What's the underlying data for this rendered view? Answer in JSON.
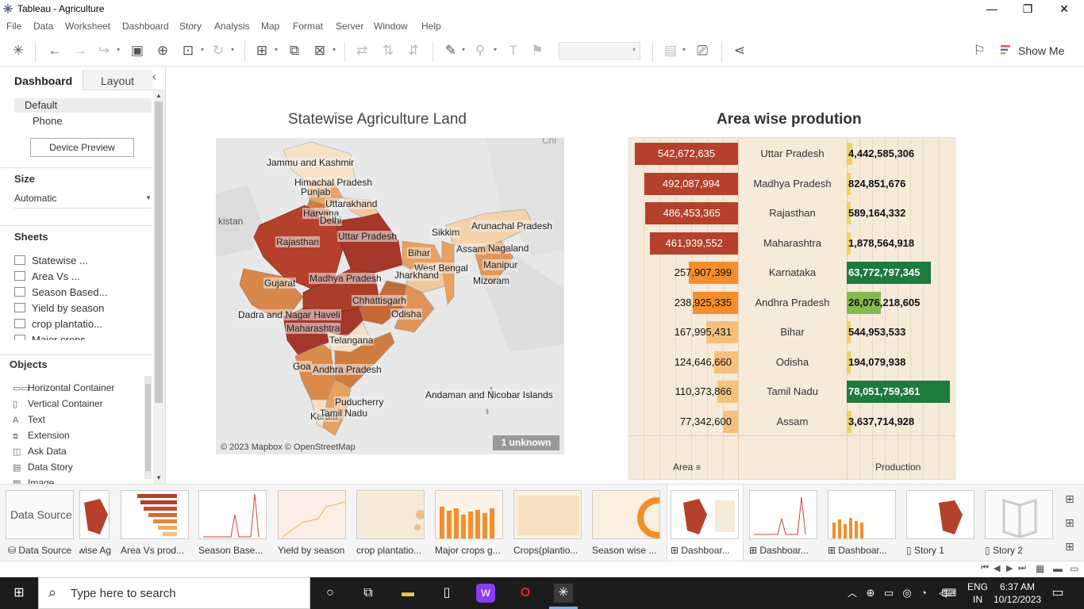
{
  "app": {
    "title": "Tableau - Agriculture"
  },
  "menu": [
    "File",
    "Data",
    "Worksheet",
    "Dashboard",
    "Story",
    "Analysis",
    "Map",
    "Format",
    "Server",
    "Window",
    "Help"
  ],
  "toolbar": {
    "show_me": "Show Me"
  },
  "left_pane": {
    "tabs": [
      "Dashboard",
      "Layout"
    ],
    "device": {
      "default": "Default",
      "phone": "Phone",
      "preview_button": "Device Preview"
    },
    "size": {
      "header": "Size",
      "value": "Automatic"
    },
    "sheets": {
      "header": "Sheets",
      "items": [
        "Statewise ...",
        "Area Vs ...",
        "Season Based...",
        "Yield by season",
        "crop plantatio...",
        "Major crops ..."
      ]
    },
    "objects": {
      "header": "Objects",
      "items": [
        {
          "icon": "horizontal-container-icon",
          "label": "Horizontal Container"
        },
        {
          "icon": "vertical-container-icon",
          "label": "Vertical Container"
        },
        {
          "icon": "text-icon",
          "label": "Text"
        },
        {
          "icon": "extension-icon",
          "label": "Extension"
        },
        {
          "icon": "ask-data-icon",
          "label": "Ask Data"
        },
        {
          "icon": "data-story-icon",
          "label": "Data Story"
        },
        {
          "icon": "image-icon",
          "label": "Image"
        }
      ]
    }
  },
  "dashboard": {
    "map": {
      "title": "Statewise Agriculture Land",
      "labels": [
        "Chi",
        "kistan",
        "Jammu and Kashmir",
        "Himachal Pradesh",
        "Punjab",
        "Uttarakhand",
        "Haryana",
        "Delhi",
        "Rajasthan",
        "Uttar Pradesh",
        "Sikkim",
        "Arunachal Pradesh",
        "Assam",
        "Nagaland",
        "Bihar",
        "West Bengal",
        "Manipur",
        "Jharkhand",
        "Mizoram",
        "Gujarat",
        "Madhya Pradesh",
        "Chhattisgarh",
        "Odisha",
        "Dadra and Nagar Haveli",
        "Maharashtra",
        "Telangana",
        "Goa",
        "Andhra Pradesh",
        "Andaman and Nicobar Islands",
        "Puducherry",
        "Karala",
        "Tamil Nadu"
      ],
      "attribution": "© 2023 Mapbox © OpenStreetMap",
      "unknown": "1 unknown"
    },
    "bars": {
      "title": "Area wise prodution",
      "footer": {
        "area": "Area",
        "production": "Production"
      },
      "colors": {
        "area_dark": "#b5402b",
        "area_mid": "#f28e2b",
        "area_light": "#f4c17c",
        "prod_yellow": "#efd160",
        "prod_green": "#1e7b3d",
        "prod_lightgreen": "#86b94f"
      }
    }
  },
  "chart_data": {
    "type": "bar",
    "categories": [
      "Uttar Pradesh",
      "Madhya Pradesh",
      "Rajasthan",
      "Maharashtra",
      "Karnataka",
      "Andhra Pradesh",
      "Bihar",
      "Odisha",
      "Tamil Nadu",
      "Assam"
    ],
    "series": [
      {
        "name": "Area",
        "values": [
          542672635,
          492087994,
          486453365,
          461939552,
          257907399,
          238925335,
          167995431,
          124646660,
          110373866,
          77342600
        ],
        "labels": [
          "542,672,635",
          "492,087,994",
          "486,453,365",
          "461,939,552",
          "257,907,399",
          "238,925,335",
          "167,995,431",
          "124,646,660",
          "110,373,866",
          "77,342,600"
        ]
      },
      {
        "name": "Production",
        "values": [
          4442585306,
          824851676,
          589164332,
          1878564918,
          63772797345,
          26076218605,
          544953533,
          194079938,
          78051759361,
          3637714928
        ],
        "labels": [
          "4,442,585,306",
          "824,851,676",
          "589,164,332",
          "1,878,564,918",
          "63,772,797,345",
          "26,076,218,605",
          "544,953,533",
          "194,079,938",
          "78,051,759,361",
          "3,637,714,928"
        ]
      }
    ],
    "title": "Area wise prodution",
    "xlabel": "Area",
    "ylabel": "Production"
  },
  "tabs": [
    {
      "label": "Data Source",
      "thumb": "Data Source"
    },
    {
      "label": "Statewise Ag..."
    },
    {
      "label": "Area Vs prod..."
    },
    {
      "label": "Season Base..."
    },
    {
      "label": "Yield by season"
    },
    {
      "label": "crop plantatio..."
    },
    {
      "label": "Major crops g..."
    },
    {
      "label": "Crops(plantio..."
    },
    {
      "label": "Season wise ..."
    },
    {
      "label": "Dashboar...",
      "active": true
    },
    {
      "label": "Dashboar..."
    },
    {
      "label": "Dashboar..."
    },
    {
      "label": "Story 1"
    },
    {
      "label": "Story 2"
    }
  ],
  "taskbar": {
    "search_placeholder": "Type here to search",
    "lang1": "ENG",
    "lang2": "IN",
    "time": "6:37 AM",
    "date": "10/12/2023"
  }
}
